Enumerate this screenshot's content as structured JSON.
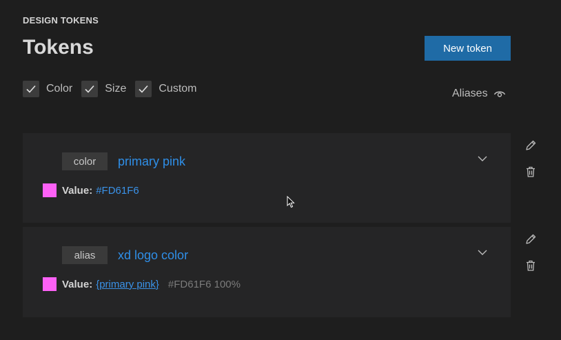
{
  "header": {
    "eyebrow": "DESIGN TOKENS",
    "title": "Tokens",
    "new_button": "New token"
  },
  "filters": [
    {
      "label": "Color",
      "checked": true
    },
    {
      "label": "Size",
      "checked": true
    },
    {
      "label": "Custom",
      "checked": true
    }
  ],
  "aliases": {
    "label": "Aliases",
    "icon": "eye-icon"
  },
  "tokens": [
    {
      "type": "color",
      "name": "primary pink",
      "value_label": "Value:",
      "value": "#FD61F6",
      "swatch_color": "#FD61F6"
    },
    {
      "type": "alias",
      "name": "xd logo color",
      "value_label": "Value:",
      "value": "{primary pink}",
      "resolved": "#FD61F6 100%",
      "swatch_color": "#FD61F6"
    }
  ],
  "colors": {
    "accent": "#1F6BA6",
    "link": "#2F8FE8",
    "background": "#1E1E1E",
    "card": "#252526"
  }
}
